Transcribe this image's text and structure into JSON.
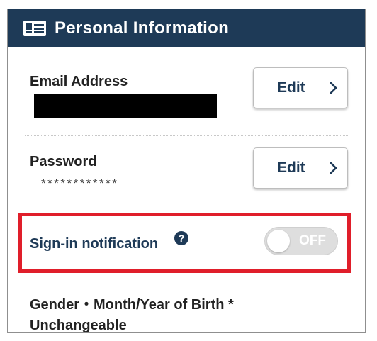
{
  "header": {
    "title": "Personal Information",
    "icon": "id-card-icon"
  },
  "email": {
    "label": "Email Address",
    "edit_label": "Edit"
  },
  "password": {
    "label": "Password",
    "masked_value": "************",
    "edit_label": "Edit"
  },
  "signin_notification": {
    "label": "Sign-in notification",
    "toggle_state": "OFF",
    "help_icon": "?"
  },
  "gender": {
    "line1": "Gender・Month/Year of Birth *",
    "line2": "Unchangeable"
  },
  "colors": {
    "header_bg": "#1e3a57",
    "accent": "#1e3a57",
    "highlight": "#e01e2a",
    "toggle_off": "#dedede"
  }
}
